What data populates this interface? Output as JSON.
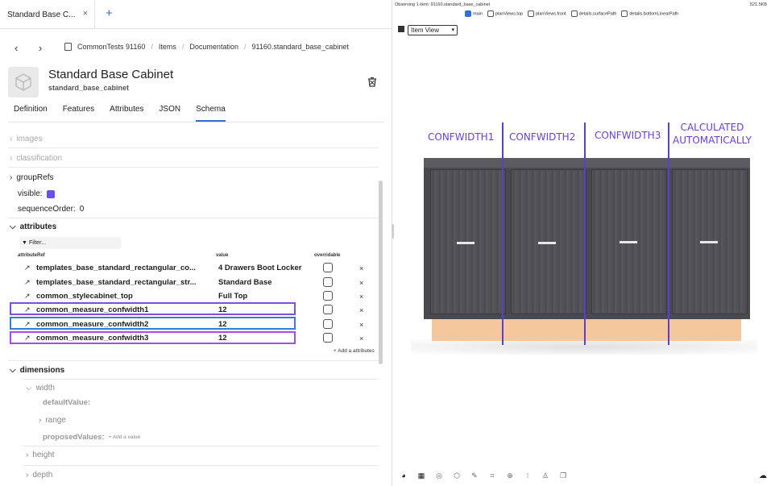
{
  "tabbar": {
    "tab_title": "Standard Base C...",
    "close": "×",
    "add": "+"
  },
  "nav": {
    "back": "‹",
    "forward": "›"
  },
  "breadcrumb": [
    "CommonTests 91160",
    "Items",
    "Documentation",
    "91160.standard_base_cabinet"
  ],
  "breadcrumb_sep": "/",
  "header": {
    "title": "Standard Base Cabinet",
    "subtitle": "standard_base_cabinet"
  },
  "subtabs": [
    "Definition",
    "Features",
    "Attributes",
    "JSON",
    "Schema"
  ],
  "active_subtab": "Schema",
  "schema": {
    "images": "images",
    "classification": "classification",
    "groupRefs": "groupRefs",
    "visible_label": "visible:",
    "visible_color": "#6b4ee6",
    "sequenceOrder_label": "sequenceOrder:",
    "sequenceOrder_value": "0",
    "attributes": "attributes",
    "filter_placeholder": "Filter...",
    "col_ref": "attributeRef",
    "col_value": "value",
    "col_overridable": "overridable",
    "rows": [
      {
        "name": "templates_base_standard_rectangular_co...",
        "value": "4 Drawers Boot Locker"
      },
      {
        "name": "templates_base_standard_rectangular_str...",
        "value": "Standard Base"
      },
      {
        "name": "common_stylecabinet_top",
        "value": "Full Top"
      },
      {
        "name": "common_measure_confwidth1",
        "value": "12"
      },
      {
        "name": "common_measure_confwidth2",
        "value": "12"
      },
      {
        "name": "common_measure_confwidth3",
        "value": "12"
      }
    ],
    "remove": "×",
    "highlight_colors": [
      "#7b4fe0",
      "#3a7bd5",
      "#a64de8"
    ],
    "add_attributes": "+ Add a attributes",
    "dimensions": "dimensions",
    "width": "width",
    "defaultValue": "defaultValue:",
    "range": "range",
    "proposedValues": "proposedValues:",
    "add_value": "+ Add a value",
    "height": "height",
    "depth": "depth"
  },
  "viewer": {
    "observing": "Observing 1 item: 91160.standard_base_cabinet",
    "size": "521.5KB",
    "checkboxes": [
      {
        "label": "main",
        "checked": true
      },
      {
        "label": "planViews.top",
        "checked": false
      },
      {
        "label": "planViews.front",
        "checked": false
      },
      {
        "label": "details.surfacePath",
        "checked": false
      },
      {
        "label": "details.bottomLinearPath",
        "checked": false
      }
    ],
    "view_select": "Item View",
    "labels": [
      "CONFWIDTH1",
      "CONFWIDTH2",
      "CONFWIDTH3",
      "CALCULATED",
      "AUTOMATICALLY"
    ],
    "label_color": "#6b3fd4",
    "line_color": "#5a3ed8",
    "toolbar_icons": [
      "palette-icon",
      "grid-icon",
      "compass-icon",
      "cube-icon",
      "brush-icon",
      "frame-icon",
      "target-icon",
      "dots-icon",
      "person-icon",
      "layers-icon"
    ],
    "cloud_icon": "cloud-upload-icon"
  }
}
